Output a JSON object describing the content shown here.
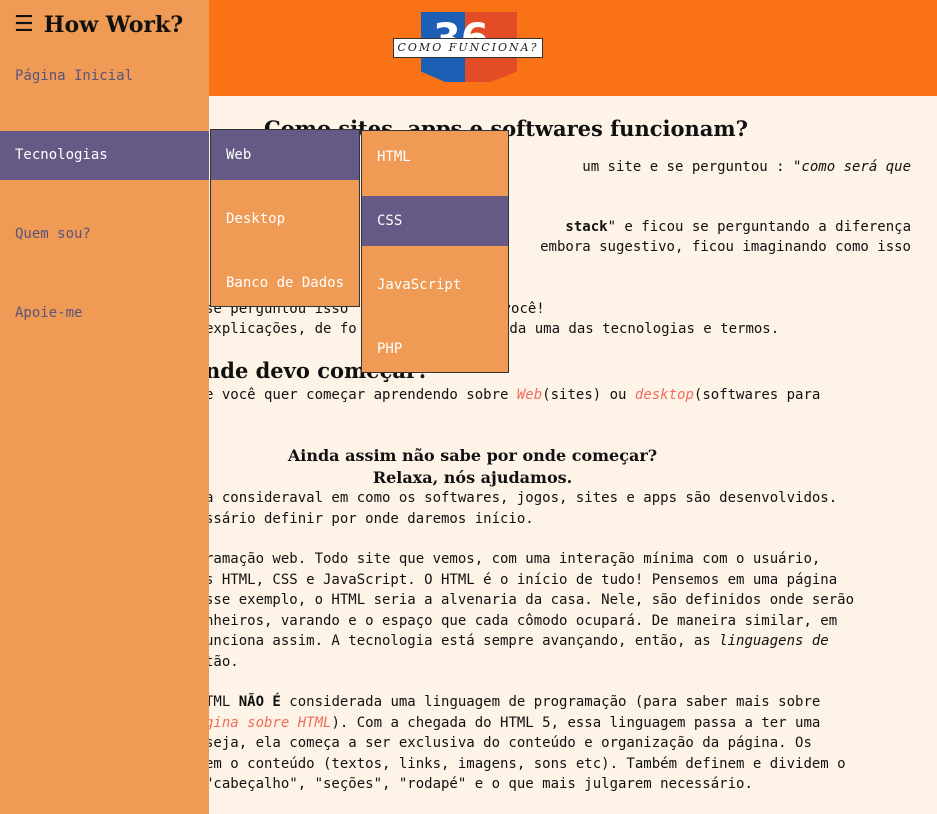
{
  "header": {
    "logo_digits": "36",
    "logo_text": "COMO FUNCIONA?"
  },
  "sidebar": {
    "brand": "How Work?",
    "items": [
      {
        "label": "Página Inicial"
      },
      {
        "label": "Tecnologias"
      },
      {
        "label": "Quem sou?"
      },
      {
        "label": "Apoie-me"
      }
    ]
  },
  "dropdown": {
    "level1": [
      "Web",
      "Desktop",
      "Banco de Dados"
    ],
    "level2": [
      "HTML",
      "CSS",
      "JavaScript",
      "PHP"
    ]
  },
  "content": {
    "title": "Como sites, apps e softwares funcionam?",
    "p1_a": "um site e se perguntou : \"",
    "p1_b": "como será que",
    "p2_bold": "stack",
    "p2_a": "\" e ficou se perguntando a diferença",
    "p2_b": "embora sugestivo, ficou imaginando como isso",
    "p3_a": "se perguntou isso",
    "p3_b": "te é para você!",
    "p3_c": "explicações, de fo",
    "p3_d": "s, sobre cada uma das tecnologias e termos.",
    "subtitle": "nde devo começar?",
    "p4_a": "e você quer começar aprendendo sobre ",
    "p4_link1": "Web",
    "p4_b": "(sites) ou ",
    "p4_link2": "desktop",
    "p4_c": "(softwares para",
    "q1": "Ainda assim não sabe por onde começar?",
    "q2": "Relaxa, nós ajudamos.",
    "p5_a": "a consideraval em como os softwares, jogos, sites e apps são desenvolvidos.",
    "p5_b": "ssário definir por onde daremos início.",
    "p6_a": "ramação web. Todo site que vemos, com uma interação mínima com o usuário,",
    "p6_b": "s HTML, CSS e JavaScript. O HTML é o início de tudo! Pensemos em uma página",
    "p6_c": "sse exemplo, o HTML seria a alvenaria da casa. Nele, são definidos onde serão",
    "p6_d": "nheiros, varando e o espaço que cada cômodo ocupará. De maneira similar, em",
    "p6_e": "unciona assim. A tecnologia está sempre avançando, então, as ",
    "p6_e_italic": "linguagens de",
    "p6_f": "tão.",
    "p7_a1": "TML ",
    "p7_a_bold": "NÃO É",
    "p7_a2": " considerada uma linguagem de programação (para saber mais sobre",
    "p7_b_link": "gina sobre HTML",
    "p7_b": "). Com a chegada do HTML 5, essa linguagem passa a ter uma",
    "p7_c": " seja, ela começa a ser exclusiva do conteúdo e organização da página. Os",
    "p7_d": "em o conteúdo (textos, links, imagens, sons etc). Também definem e dividem o",
    "p7_e": "\"cabeçalho\", \"seções\", \"rodapé\" e o que mais julgarem necessário."
  }
}
